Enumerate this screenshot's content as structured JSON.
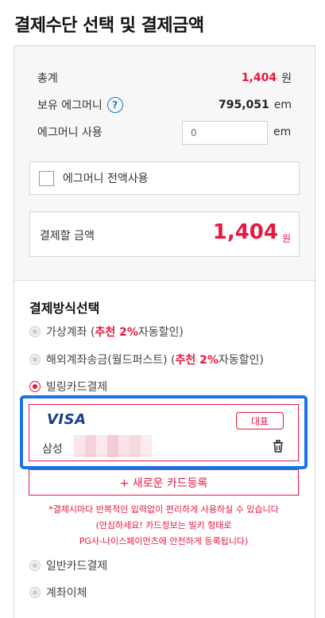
{
  "page_title": "결제수단 선택 및 결제금액",
  "summary": {
    "total_label": "총계",
    "total_amount": "1,404",
    "total_unit": "원",
    "held_label": "보유 에그머니",
    "help_icon_text": "?",
    "held_amount": "795,051",
    "held_unit": "em",
    "use_label": "에그머니 사용",
    "use_placeholder": "0",
    "use_unit": "em",
    "use_all_label": "에그머니 전액사용",
    "pay_label": "결제할 금액",
    "pay_amount": "1,404",
    "pay_unit": "원"
  },
  "methods": {
    "title": "결제방식선택",
    "virtual_account": {
      "prefix": "가상계좌 (",
      "rec": "추천 2%",
      "suffix": "자동할인)"
    },
    "overseas_transfer": {
      "prefix": "해외계좌송금(월드퍼스트) (",
      "rec": "추천 2%",
      "suffix": "자동할인)"
    },
    "billing_card": "빌링카드결제",
    "general_card": "일반카드결제",
    "bank_transfer": "계좌이체"
  },
  "card": {
    "brand": "VISA",
    "badge": "대표",
    "issuer": "삼성"
  },
  "new_card_label": "+ 새로운 카드등록",
  "notice_lines": [
    "*결제시마다 반복적인 입력없이 편리하게 사용하실 수 있습니다",
    "(안심하세요! 카드정보는 빌키 형태로",
    "PG사-나이스페이먼츠에 안전하게 등록됩니다)"
  ],
  "colors": {
    "accent_red": "#e8173f",
    "highlight_blue": "#1a73e8",
    "visa_blue": "#1a3e8f"
  }
}
